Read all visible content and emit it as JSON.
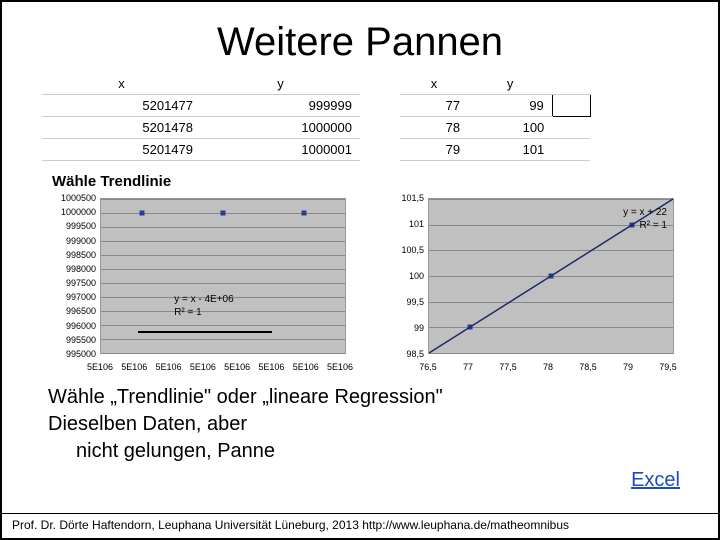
{
  "title": "Weitere Pannen",
  "table_left": {
    "headers": [
      "x",
      "y"
    ],
    "rows": [
      [
        "5201477",
        "999999"
      ],
      [
        "5201478",
        "1000000"
      ],
      [
        "5201479",
        "1000001"
      ]
    ]
  },
  "table_right": {
    "headers": [
      "x",
      "y"
    ],
    "rows": [
      [
        "77",
        "99"
      ],
      [
        "78",
        "100"
      ],
      [
        "79",
        "101"
      ]
    ]
  },
  "subheading": "Wähle Trendlinie",
  "chart_data": [
    {
      "type": "scatter",
      "x": [
        5201477,
        5201478,
        5201479
      ],
      "y": [
        999999,
        1000000,
        1000001
      ],
      "yticks": [
        995000,
        995500,
        996000,
        996500,
        997000,
        997500,
        998000,
        998500,
        999000,
        999500,
        1000000,
        1000500
      ],
      "xticks_labels": [
        "5E106",
        "5E106",
        "5E106",
        "5E106",
        "5E106",
        "5E106",
        "5E106",
        "5E106"
      ],
      "eq_line1": "y = x - 4E+06",
      "eq_line2": "R² = 1",
      "trend_fit": {
        "slope": 1,
        "intercept": -4000000
      }
    },
    {
      "type": "scatter",
      "x": [
        77,
        78,
        79
      ],
      "y": [
        99,
        100,
        101
      ],
      "yticks": [
        98.5,
        99,
        99.5,
        100,
        100.5,
        101,
        101.5
      ],
      "xticks": [
        76.5,
        77,
        77.5,
        78,
        78.5,
        79,
        79.5
      ],
      "eq_line1": "y = x + 22",
      "eq_line2": "R² = 1",
      "trend_fit": {
        "slope": 1,
        "intercept": 22
      }
    }
  ],
  "bodytext": {
    "line1": "Wähle „Trendlinie\" oder „lineare Regression\"",
    "line2": "Dieselben Daten, aber",
    "line3": "nicht gelungen, Panne"
  },
  "link_label": "Excel",
  "footer": "Prof. Dr. Dörte Haftendorn, Leuphana Universität Lüneburg, 2013 http://www.leuphana.de/matheomnibus"
}
